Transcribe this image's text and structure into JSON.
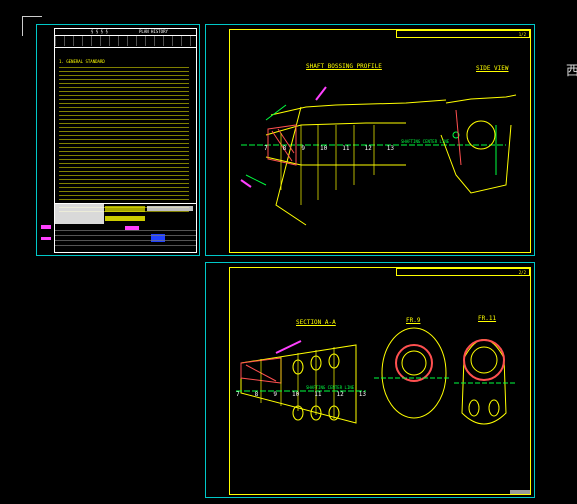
{
  "sheet1": {
    "header_title": "PLAN HISTORY",
    "header_left": "§ § § §",
    "notes_title": "1. GENERAL STANDARD"
  },
  "sheet2": {
    "view1_title": "SHAFT BOSSING PROFILE",
    "view2_title": "SIDE VIEW",
    "page": "1/2",
    "frame_numbers": [
      "7",
      "8",
      "9",
      "10",
      "11",
      "12",
      "13"
    ],
    "centerline": "SHAFTING CENTER LINE"
  },
  "sheet3": {
    "view1_title": "SECTION A-A",
    "view2_title": "FR.9",
    "view3_title": "FR.11",
    "page": "2/2",
    "frame_numbers": [
      "7",
      "8",
      "9",
      "10",
      "11",
      "12",
      "13"
    ],
    "centerline": "SHAFTING CENTER LINE"
  },
  "side_label": "西",
  "colors": {
    "frame": "#00c8c8",
    "border": "#ffff00",
    "hatch": "#ff5050",
    "dim": "#00ff40",
    "text": "#ffffff"
  }
}
